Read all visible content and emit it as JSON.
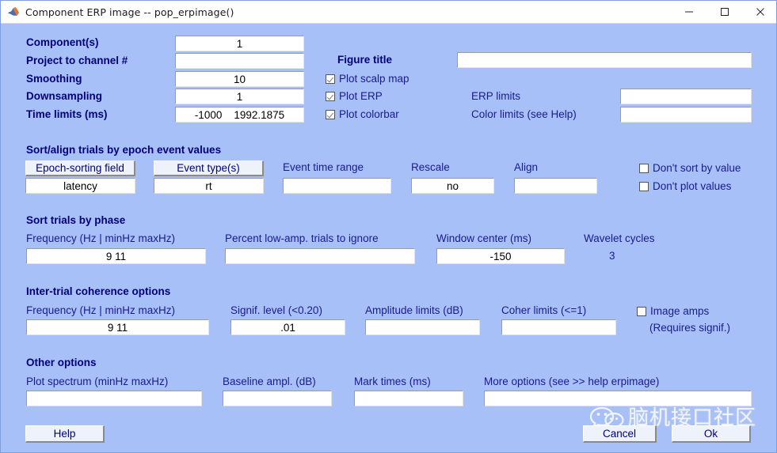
{
  "window": {
    "title": "Component ERP image -- pop_erpimage()",
    "icon": "matlab-icon",
    "background_color": "#a8c0f8",
    "controls": [
      {
        "name": "minimize",
        "glyph": "─"
      },
      {
        "name": "maximize",
        "glyph": "□"
      },
      {
        "name": "close",
        "glyph": "✕"
      }
    ]
  },
  "top": {
    "labels": {
      "components": "Component(s)",
      "project_channel": "Project to channel #",
      "smoothing": "Smoothing",
      "downsampling": "Downsampling",
      "time_limits": "Time limits (ms)",
      "figure_title": "Figure title",
      "erp_limits": "ERP limits",
      "color_limits": "Color limits (see Help)"
    },
    "values": {
      "components": "1",
      "project_channel": "",
      "smoothing": "10",
      "downsampling": "1",
      "time_limits": "-1000    1992.1875",
      "figure_title": "",
      "erp_limits": "",
      "color_limits": ""
    },
    "checkboxes": [
      {
        "label": "Plot scalp map",
        "checked": true
      },
      {
        "label": "Plot ERP",
        "checked": true
      },
      {
        "label": "Plot colorbar",
        "checked": true
      }
    ]
  },
  "sort_align": {
    "section_title": "Sort/align trials by epoch event values",
    "buttons": {
      "epoch_sorting_field": "Epoch-sorting field",
      "event_types": "Event type(s)"
    },
    "labels": {
      "event_time_range": "Event time range",
      "rescale": "Rescale",
      "align": "Align"
    },
    "values": {
      "epoch_sorting_field": "latency",
      "event_types": "rt",
      "event_time_range": "",
      "rescale": "no",
      "align": ""
    },
    "checkboxes": [
      {
        "label": "Don't sort by value",
        "checked": false
      },
      {
        "label": "Don't plot values",
        "checked": false
      }
    ]
  },
  "sort_phase": {
    "section_title": "Sort trials by phase",
    "labels": {
      "frequency": "Frequency (Hz | minHz maxHz)",
      "percent_low_amp": "Percent low-amp. trials to ignore",
      "window_center": "Window center (ms)",
      "wavelet_cycles": "Wavelet cycles"
    },
    "values": {
      "frequency": "9 11",
      "percent_low_amp": "",
      "window_center": "-150",
      "wavelet_cycles": "3"
    }
  },
  "coherence": {
    "section_title": "Inter-trial coherence options",
    "labels": {
      "frequency": "Frequency (Hz | minHz maxHz)",
      "signif_level": "Signif. level (<0.20)",
      "amplitude_limits": "Amplitude limits (dB)",
      "coher_limits": "Coher limits (<=1)"
    },
    "values": {
      "frequency": "9 11",
      "signif_level": ".01",
      "amplitude_limits": "",
      "coher_limits": ""
    },
    "checkbox": {
      "label": "Image amps",
      "checked": false
    },
    "checkbox_sub": "(Requires signif.)"
  },
  "other": {
    "section_title": "Other options",
    "labels": {
      "plot_spectrum": "Plot spectrum (minHz maxHz)",
      "baseline_ampl": "Baseline ampl. (dB)",
      "mark_times": "Mark times (ms)",
      "more_options": "More options (see >> help erpimage)"
    },
    "values": {
      "plot_spectrum": "",
      "baseline_ampl": "",
      "mark_times": "",
      "more_options": ""
    }
  },
  "footer": {
    "help": "Help",
    "cancel": "Cancel",
    "ok": "Ok"
  },
  "watermark": {
    "text": "脑机接口社区",
    "logo": "wechat-logo"
  }
}
